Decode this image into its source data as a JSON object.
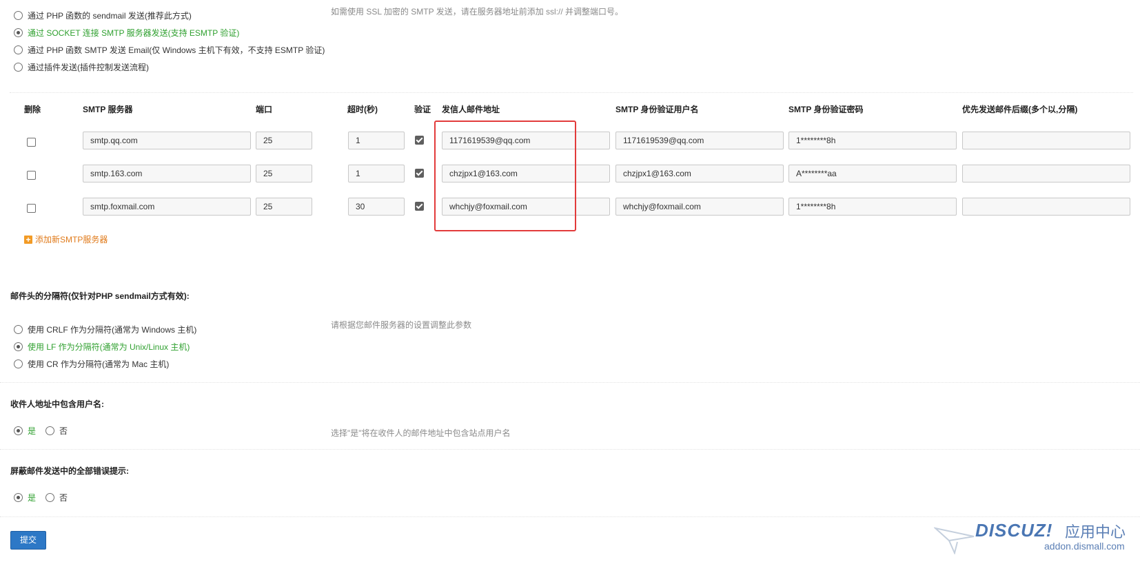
{
  "mail_method": {
    "options": [
      "通过 PHP 函数的 sendmail 发送(推荐此方式)",
      "通过 SOCKET 连接 SMTP 服务器发送(支持 ESMTP 验证)",
      "通过 PHP 函数 SMTP 发送 Email(仅 Windows 主机下有效，不支持 ESMTP 验证)",
      "通过插件发送(插件控制发送流程)"
    ],
    "selected_index": 1,
    "hint": "如需使用 SSL 加密的 SMTP 发送，请在服务器地址前添加 ssl:// 并调整端口号。"
  },
  "smtp_table": {
    "headers": [
      "删除",
      "SMTP 服务器",
      "端口",
      "超时(秒)",
      "验证",
      "发信人邮件地址",
      "SMTP 身份验证用户名",
      "SMTP 身份验证密码",
      "优先发送邮件后缀(多个以,分隔)"
    ],
    "rows": [
      {
        "delete": false,
        "server": "smtp.qq.com",
        "port": "25",
        "timeout": "1",
        "auth": true,
        "from": "1171619539@qq.com",
        "username": "1171619539@qq.com",
        "password": "1********8h",
        "suffix": ""
      },
      {
        "delete": false,
        "server": "smtp.163.com",
        "port": "25",
        "timeout": "1",
        "auth": true,
        "from": "chzjpx1@163.com",
        "username": "chzjpx1@163.com",
        "password": "A********aa",
        "suffix": ""
      },
      {
        "delete": false,
        "server": "smtp.foxmail.com",
        "port": "25",
        "timeout": "30",
        "auth": true,
        "from": "whchjy@foxmail.com",
        "username": "whchjy@foxmail.com",
        "password": "1********8h",
        "suffix": ""
      }
    ],
    "add_label": "添加新SMTP服务器",
    "highlight_color": "#e23a3a"
  },
  "delimiter": {
    "title": "邮件头的分隔符(仅针对PHP sendmail方式有效):",
    "options": [
      "使用 CRLF 作为分隔符(通常为 Windows 主机)",
      "使用 LF 作为分隔符(通常为 Unix/Linux 主机)",
      "使用 CR 作为分隔符(通常为 Mac 主机)"
    ],
    "selected_index": 1,
    "hint": "请根据您邮件服务器的设置调整此参数"
  },
  "include_username": {
    "title": "收件人地址中包含用户名:",
    "yes": "是",
    "no": "否",
    "selected": "yes",
    "hint": "选择\"是\"将在收件人的邮件地址中包含站点用户名"
  },
  "silent_errors": {
    "title": "屏蔽邮件发送中的全部错误提示:",
    "yes": "是",
    "no": "否",
    "selected": "yes"
  },
  "submit_label": "提交",
  "watermark": {
    "brand": "DISCUZ!",
    "sub": "应用中心",
    "url": "addon.dismall.com"
  },
  "colors": {
    "accent_green": "#2fa02f",
    "submit_blue": "#2d78c6",
    "add_orange": "#e07a1a"
  }
}
